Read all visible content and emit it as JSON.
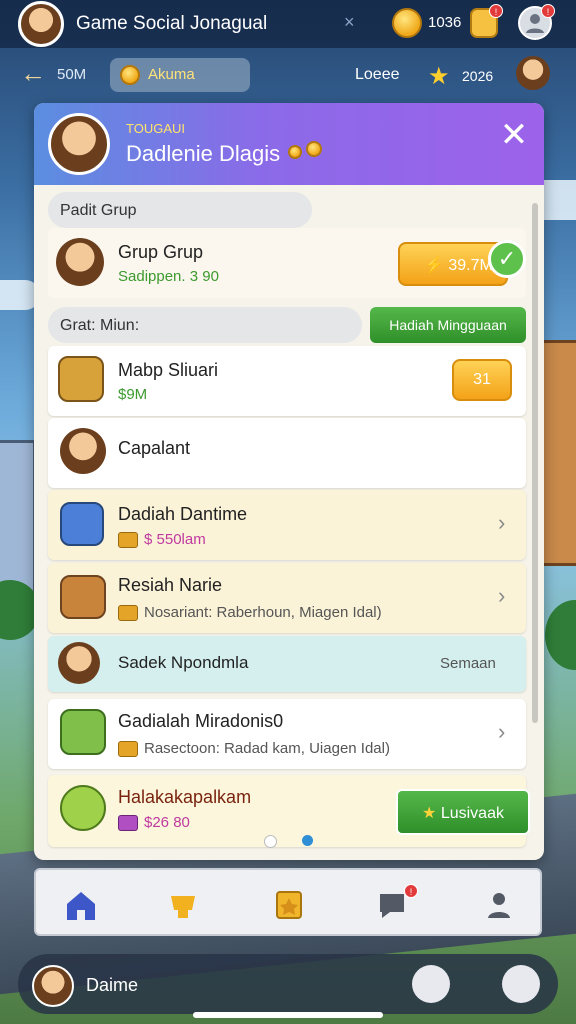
{
  "topbar": {
    "title": "Game Social Jonagual",
    "close_glyph": "×",
    "coin_count": "1036",
    "notification_badge": "!"
  },
  "subbar": {
    "back_glyph": "←",
    "left_label": "50M",
    "pill_label": "Akuma",
    "right_label": "Loeee",
    "right_count": "2026"
  },
  "modal": {
    "subtitle": "TOUGAUI",
    "title": "Dadlenie Dlagis",
    "close_glyph": "✕",
    "section1_label": "Padit Grup",
    "group_card": {
      "title": "Grup Grup",
      "subtitle": "Sadippen. 3 90",
      "button_label": "⚡ 39.7M"
    },
    "section2_label": "Grat: Miun:",
    "weekly_button": "Hadiah Mingguaan",
    "items": [
      {
        "title": "Mabp Sliuari",
        "subtitle": "$9M",
        "button": "31"
      },
      {
        "title": "Capalant"
      },
      {
        "title": "Dadiah Dantime",
        "subtitle": "$ 550lam"
      },
      {
        "title": "Resiah Narie",
        "subtitle": "Nosariant: Raberhoun, Miagen Idal)"
      },
      {
        "title": "Sadek Npondmla",
        "right_text": "Semaan"
      },
      {
        "title": "Gadialah Miradonis0",
        "subtitle": "Rasectoon: Radad kam, Uiagen Idal)"
      },
      {
        "title": "Halakakapalkam",
        "subtitle": "$26 80",
        "button": "Lusivaak"
      }
    ],
    "chevron_glyph": "›"
  },
  "bottom": {
    "label": "Daime"
  },
  "colors": {
    "accent_purple": "#9c62ea",
    "accent_green": "#2f8f2a",
    "accent_orange": "#f3a218",
    "notification_red": "#e23a3a"
  },
  "icons": [
    "home-icon",
    "trophy-icon",
    "badge-icon",
    "chat-icon",
    "profile-icon",
    "settings-icon"
  ]
}
